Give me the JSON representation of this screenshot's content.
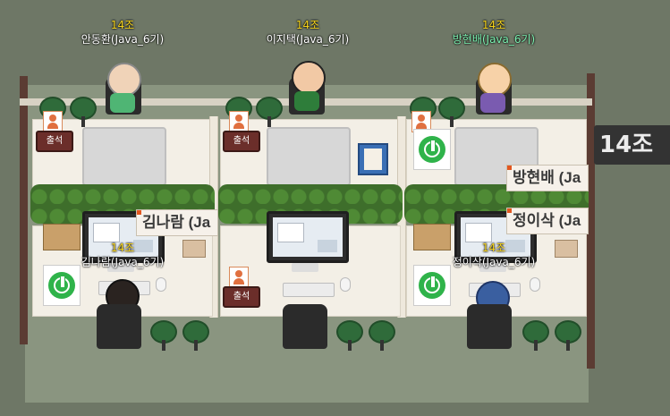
{
  "colors": {
    "team_label": "#f4d21a",
    "name_label": "#ffffff",
    "name_highlight": "#7bf0b0",
    "power_green": "#2fb34a",
    "background": "#6e7766"
  },
  "side_sign": {
    "label": "14조"
  },
  "desks": [
    {
      "attendance_label": "출석",
      "nameplate": "김나람 (Ja",
      "status_icon": "power-icon"
    },
    {
      "attendance_label": "출석",
      "nameplate": "",
      "status_icon": "power-icon"
    },
    {
      "attendance_label": "",
      "nameplate_top": "방현배 (Ja",
      "nameplate_bottom": "정이삭 (Ja",
      "status_icon": "power-icon"
    }
  ],
  "players": [
    {
      "team": "14조",
      "name": "안동환(Java_6기)",
      "highlight": false
    },
    {
      "team": "14조",
      "name": "이지택(Java_6기)",
      "highlight": false
    },
    {
      "team": "14조",
      "name": "방현배(Java_6기)",
      "highlight": true
    },
    {
      "team": "14조",
      "name": "김나람(Java_6기)",
      "highlight": false
    },
    {
      "team": "14조",
      "name": "정이삭(Java_6기)",
      "highlight": false
    }
  ]
}
